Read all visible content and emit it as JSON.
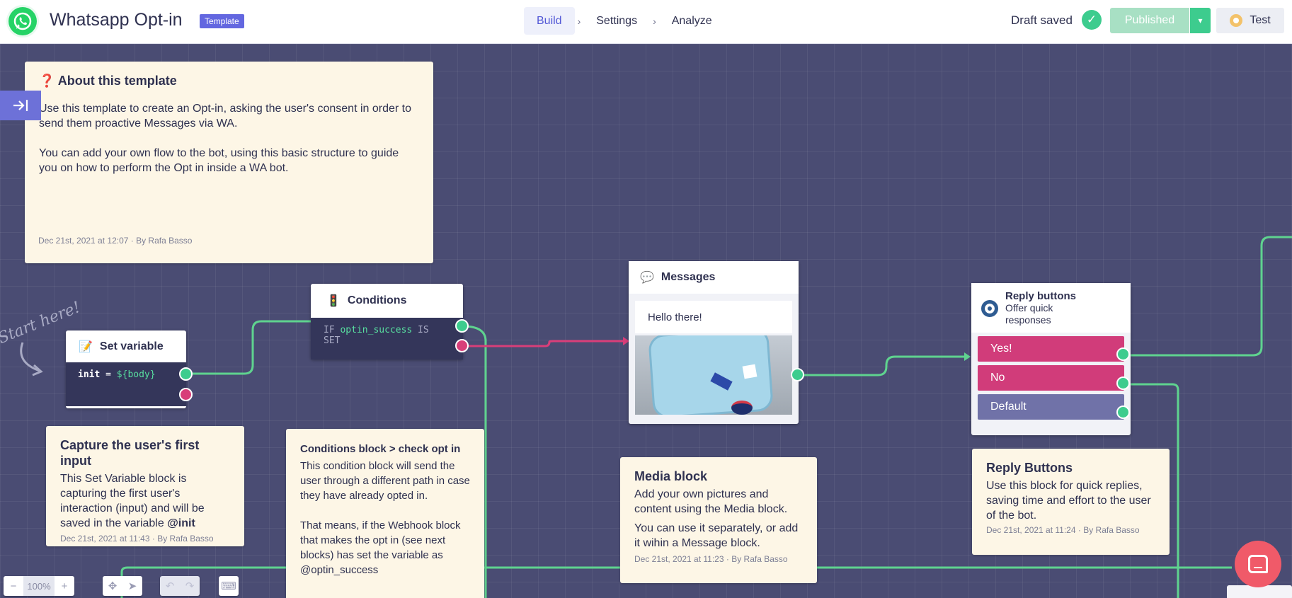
{
  "header": {
    "bot_title": "Whatsapp Opt-in",
    "badge": "Template",
    "tabs": [
      {
        "label": "Build",
        "active": true
      },
      {
        "label": "Settings",
        "active": false
      },
      {
        "label": "Analyze",
        "active": false
      }
    ],
    "separator": "›",
    "draft_status": "Draft saved",
    "publish_label": "Published",
    "test_label": "Test"
  },
  "notes": {
    "about": {
      "icon": "❓",
      "title": "About this template",
      "p1": "Use this template to create an Opt-in, asking the user's consent in order to send them proactive Messages via WA.",
      "p2": "You can add your own flow to the bot, using this basic structure to guide you on how to perform the Opt in inside a WA bot.",
      "meta": "Dec 21st, 2021 at 12:07 · By Rafa Basso"
    },
    "capture": {
      "title": "Capture the user's first input",
      "body": "This Set Variable block is capturing the first user's interaction (input) and will be saved in the variable ",
      "var": "@init",
      "meta": "Dec 21st, 2021 at 11:43 · By Rafa Basso"
    },
    "conditions_note": {
      "title": "Conditions block > check opt in",
      "p1": "This condition block will send the user through a different path in case they have already opted in.",
      "p2": "That means, if the Webhook block that makes the opt in (see next blocks) has set the variable as @optin_success"
    },
    "media": {
      "title": "Media block",
      "p1": "Add your own pictures and content using the Media block.",
      "p2": "You can use it separately, or add it wihin a Message block.",
      "meta": "Dec 21st, 2021 at 11:23 · By Rafa Basso"
    },
    "reply": {
      "title": "Reply Buttons",
      "body": "Use this block for quick replies, saving time and effort to the user of the bot.",
      "meta": "Dec 21st, 2021 at 11:24 · By Rafa Basso"
    }
  },
  "blocks": {
    "set_variable": {
      "icon": "📝",
      "title": "Set variable",
      "var_name": "init",
      "operator": " = ",
      "value": "${body}"
    },
    "conditions": {
      "icon": "🚦",
      "title": "Conditions",
      "kw_if": "IF ",
      "var_name": "optin_success",
      "kw_is_set": " IS SET"
    },
    "messages": {
      "icon": "💬",
      "title": "Messages",
      "text": "Hello there!"
    },
    "reply_buttons": {
      "title": "Reply buttons",
      "subtitle": "Offer quick responses",
      "options": [
        "Yes!",
        "No",
        "Default"
      ]
    }
  },
  "canvas": {
    "start_hint": "Start here!"
  },
  "toolbar": {
    "zoom": "100%",
    "zoom_out": "−",
    "zoom_in": "+"
  },
  "colors": {
    "canvas": "#4a4c73",
    "green_wire": "#5fd38f",
    "red_wire": "#d83e79",
    "accent": "#6367e0",
    "note_bg": "#fdf6e6",
    "reply_yes_no": "#d13c7a",
    "reply_default": "#7072a8"
  }
}
